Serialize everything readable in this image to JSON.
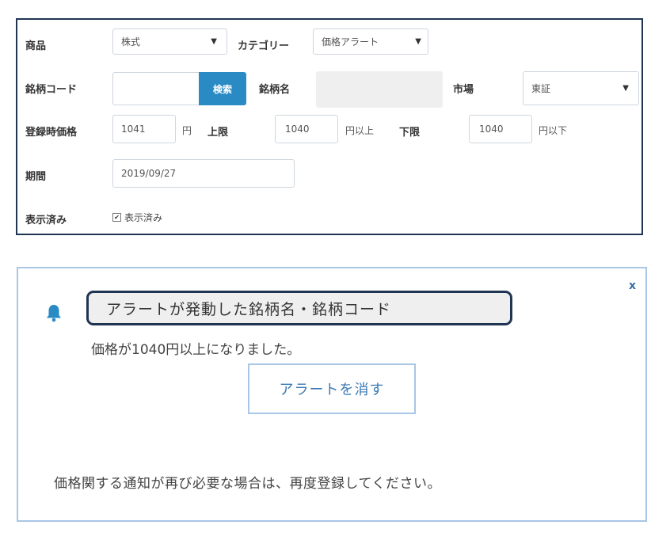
{
  "form": {
    "product_label": "商品",
    "product_value": "株式",
    "category_label": "カテゴリー",
    "category_value": "価格アラート",
    "code_label": "銘柄コード",
    "code_value": "",
    "search_button": "検索",
    "name_label": "銘柄名",
    "name_value": "",
    "market_label": "市場",
    "market_value": "東証",
    "reg_price_label": "登録時価格",
    "reg_price_value": "1041",
    "yen_unit": "円",
    "upper_label": "上限",
    "upper_value": "1040",
    "upper_unit": "円以上",
    "lower_label": "下限",
    "lower_value": "1040",
    "lower_unit": "円以下",
    "period_label": "期間",
    "period_value": "2019/09/27",
    "displayed_label": "表示済み",
    "displayed_checkbox_label": "表示済み",
    "displayed_checked": true
  },
  "alert": {
    "close_label": "x",
    "title": "アラートが発動した銘柄名・銘柄コード",
    "message": "価格が1040円以上になりました。",
    "dismiss_button": "アラートを消す",
    "footer": "価格関する通知が再び必要な場合は、再度登録してください。",
    "icon": "bell-icon",
    "accent_color": "#2a8ac4",
    "frame_color": "#1f3552"
  }
}
